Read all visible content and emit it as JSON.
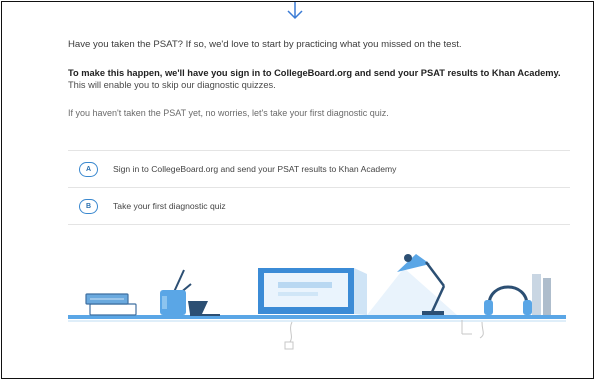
{
  "intro": {
    "question": "Have you taken the PSAT? If so, we'd love to start by practicing what you missed on the test.",
    "plan_bold": "To make this happen, we'll have you sign in to CollegeBoard.org and send your PSAT results to Khan Academy.",
    "plan_rest": " This will enable you to skip our diagnostic quizzes.",
    "no_psat": "If you haven't taken the PSAT yet, no worries, let's take your first diagnostic quiz."
  },
  "options": [
    {
      "letter": "A",
      "label": "Sign in to CollegeBoard.org and send your PSAT results to Khan Academy"
    },
    {
      "letter": "B",
      "label": "Take your first diagnostic quiz"
    }
  ],
  "colors": {
    "accent": "#3a88cf",
    "illustration_blue": "#4f9ee0",
    "shelf": "#5aa6e6"
  },
  "icons": [
    "down-arrow-icon",
    "books-icon",
    "pencil-cup-icon",
    "monitor-icon",
    "desk-lamp-icon",
    "headphones-icon"
  ]
}
